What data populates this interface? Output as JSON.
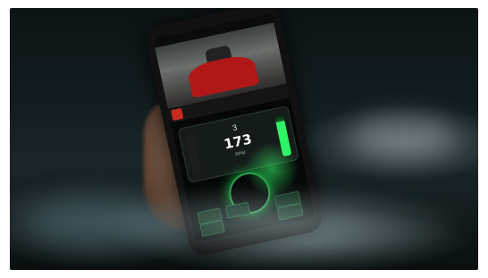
{
  "scene": {
    "description_colors": {
      "accent_green": "#2ef566",
      "car_red": "#b01818",
      "background_dark": "#0d1416"
    }
  },
  "phone_app": {
    "gear": "3",
    "speed": "173",
    "rpm_label": "RPM",
    "throttle_level": 0.85,
    "icons": [
      "car-video-icon",
      "team-badge-icon",
      "steering-wheel-icon",
      "throttle-bar-icon"
    ]
  }
}
